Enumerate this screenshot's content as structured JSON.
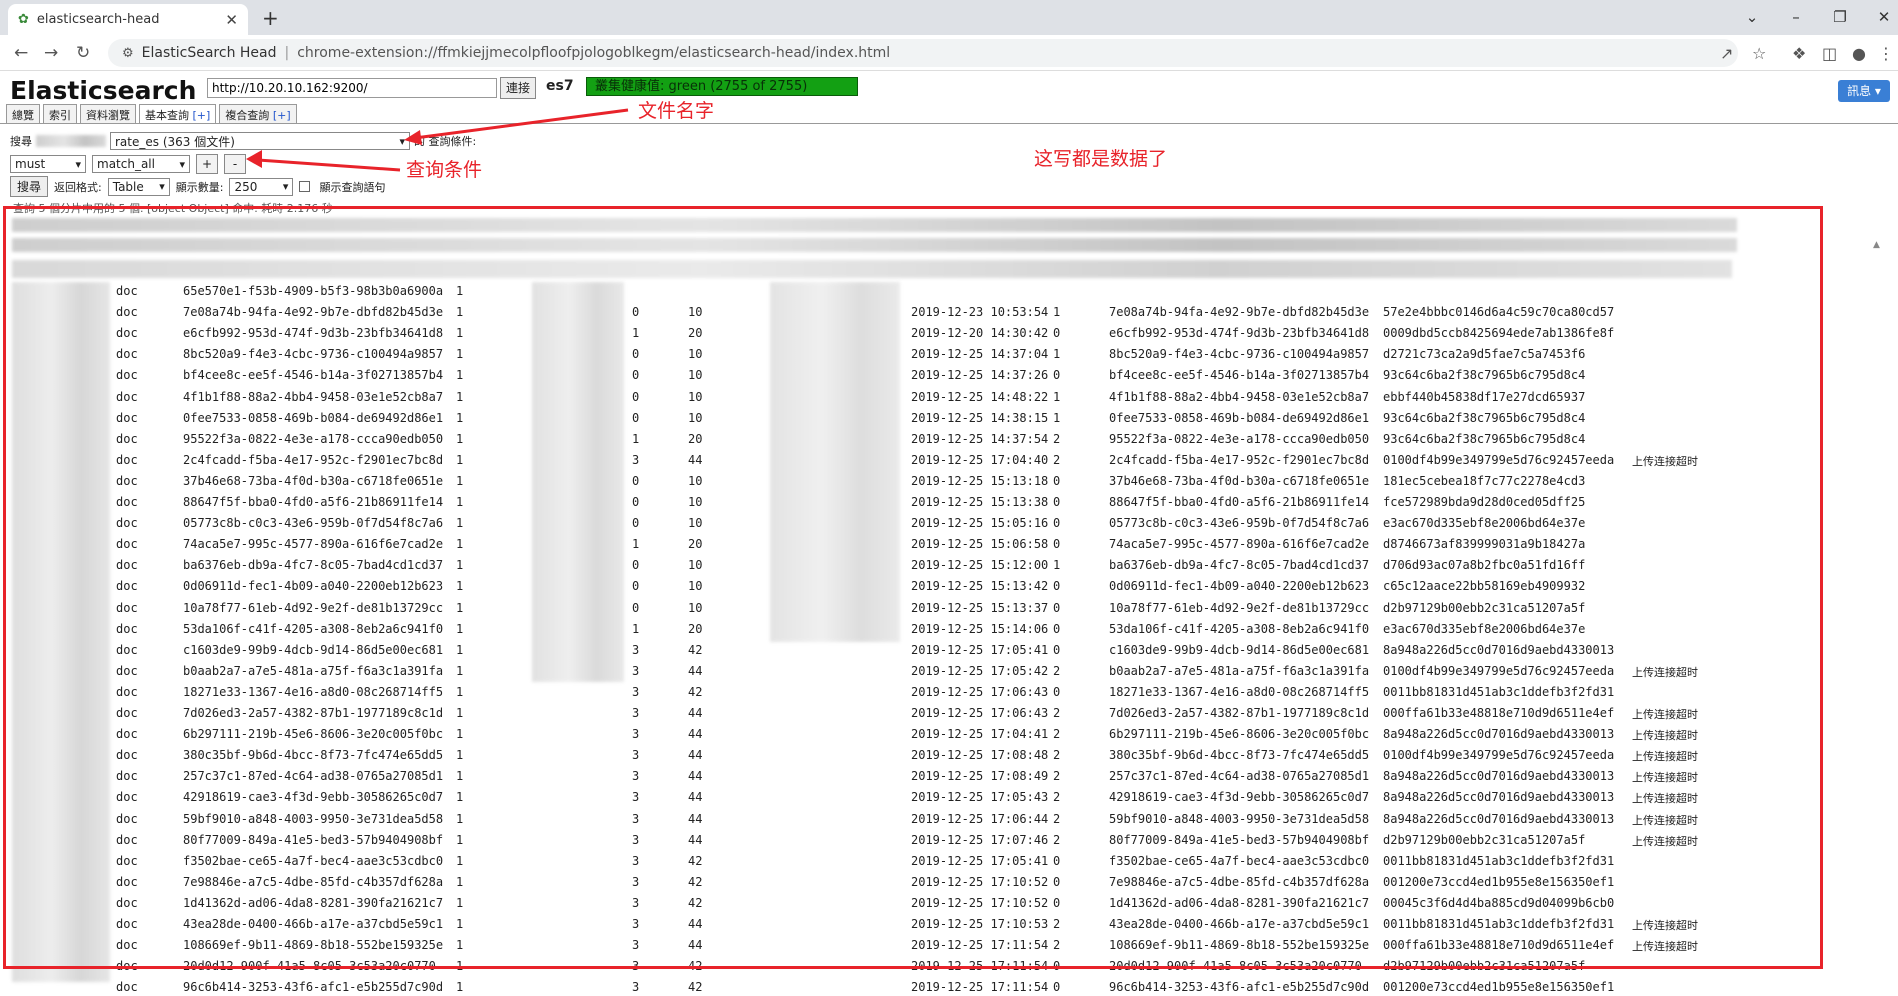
{
  "browser": {
    "tab_title": "elasticsearch-head",
    "site_name": "ElasticSearch Head",
    "url": "chrome-extension://ffmkiejjmecolpfloofpjologoblkegm/elasticsearch-head/index.html"
  },
  "app": {
    "brand": "Elasticsearch",
    "server_url": "http://10.20.10.162:9200/",
    "connect_label": "連接",
    "cluster_name": "es7",
    "health_text": "叢集健康值: green (2755 of 2755)",
    "info_label": "訊息 ▾",
    "tabs": [
      {
        "label": "總覽",
        "plus": ""
      },
      {
        "label": "索引",
        "plus": ""
      },
      {
        "label": "資料瀏覽",
        "plus": ""
      },
      {
        "label": "基本查詢",
        "plus": "[+]"
      },
      {
        "label": "複合查詢",
        "plus": "[+]"
      }
    ],
    "search_label": "搜尋",
    "index_select": "rate_es (363 個文件)",
    "query_cond_label": "的 查詢條件:",
    "must_select": "must",
    "match_select": "match_all",
    "plus_btn": "+",
    "minus_btn": "-",
    "search_button": "搜尋",
    "format_label": "返回格式:",
    "format_select": "Table",
    "size_label": "顯示數量:",
    "size_select": "250",
    "show_query_label": "顯示查詢語句",
    "status_text": "查詢 5 個分片中用的 5 個. [object Object] 命中. 耗時 2.176 秒"
  },
  "annotations": {
    "file_name": "文件名字",
    "query_cond": "查询条件",
    "data_note": "这写都是数据了"
  },
  "table": {
    "rows": [
      {
        "type": "doc",
        "id": "65e570e1-f53b-4909-b5f3-98b3b0a6900a",
        "score": "1",
        "a": "",
        "b": "",
        "date": "",
        "c": "",
        "id2": "",
        "hash": "",
        "note": ""
      },
      {
        "type": "doc",
        "id": "7e08a74b-94fa-4e92-9b7e-dbfd82b45d3e",
        "score": "1",
        "a": "0",
        "b": "10",
        "date": "2019-12-23 10:53:54",
        "c": "1",
        "id2": "7e08a74b-94fa-4e92-9b7e-dbfd82b45d3e",
        "hash": "57e2e4bbbc0146d6a4c59c70ca80cd57",
        "note": ""
      },
      {
        "type": "doc",
        "id": "e6cfb992-953d-474f-9d3b-23bfb34641d8",
        "score": "1",
        "a": "1",
        "b": "20",
        "date": "2019-12-20 14:30:42",
        "c": "0",
        "id2": "e6cfb992-953d-474f-9d3b-23bfb34641d8",
        "hash": "0009dbd5ccb8425694ede7ab1386fe8f",
        "note": ""
      },
      {
        "type": "doc",
        "id": "8bc520a9-f4e3-4cbc-9736-c100494a9857",
        "score": "1",
        "a": "0",
        "b": "10",
        "date": "2019-12-25 14:37:04",
        "c": "1",
        "id2": "8bc520a9-f4e3-4cbc-9736-c100494a9857",
        "hash": "d2721c73ca2a9d5fae7c5a7453f6",
        "note": ""
      },
      {
        "type": "doc",
        "id": "bf4cee8c-ee5f-4546-b14a-3f02713857b4",
        "score": "1",
        "a": "0",
        "b": "10",
        "date": "2019-12-25 14:37:26",
        "c": "0",
        "id2": "bf4cee8c-ee5f-4546-b14a-3f02713857b4",
        "hash": "93c64c6ba2f38c7965b6c795d8c4",
        "note": ""
      },
      {
        "type": "doc",
        "id": "4f1b1f88-88a2-4bb4-9458-03e1e52cb8a7",
        "score": "1",
        "a": "0",
        "b": "10",
        "date": "2019-12-25 14:48:22",
        "c": "1",
        "id2": "4f1b1f88-88a2-4bb4-9458-03e1e52cb8a7",
        "hash": "ebbf440b45838df17e27dcd65937",
        "note": ""
      },
      {
        "type": "doc",
        "id": "0fee7533-0858-469b-b084-de69492d86e1",
        "score": "1",
        "a": "0",
        "b": "10",
        "date": "2019-12-25 14:38:15",
        "c": "1",
        "id2": "0fee7533-0858-469b-b084-de69492d86e1",
        "hash": "93c64c6ba2f38c7965b6c795d8c4",
        "note": ""
      },
      {
        "type": "doc",
        "id": "95522f3a-0822-4e3e-a178-ccca90edb050",
        "score": "1",
        "a": "1",
        "b": "20",
        "date": "2019-12-25 14:37:54",
        "c": "2",
        "id2": "95522f3a-0822-4e3e-a178-ccca90edb050",
        "hash": "93c64c6ba2f38c7965b6c795d8c4",
        "note": ""
      },
      {
        "type": "doc",
        "id": "2c4fcadd-f5ba-4e17-952c-f2901ec7bc8d",
        "score": "1",
        "a": "3",
        "b": "44",
        "date": "2019-12-25 17:04:40",
        "c": "2",
        "id2": "2c4fcadd-f5ba-4e17-952c-f2901ec7bc8d",
        "hash": "0100df4b99e349799e5d76c92457eeda",
        "note": "上传连接超时"
      },
      {
        "type": "doc",
        "id": "37b46e68-73ba-4f0d-b30a-c6718fe0651e",
        "score": "1",
        "a": "0",
        "b": "10",
        "date": "2019-12-25 15:13:18",
        "c": "0",
        "id2": "37b46e68-73ba-4f0d-b30a-c6718fe0651e",
        "hash": "181ec5cebea18f7c77c2278e4cd3",
        "note": ""
      },
      {
        "type": "doc",
        "id": "88647f5f-bba0-4fd0-a5f6-21b86911fe14",
        "score": "1",
        "a": "0",
        "b": "10",
        "date": "2019-12-25 15:13:38",
        "c": "0",
        "id2": "88647f5f-bba0-4fd0-a5f6-21b86911fe14",
        "hash": "fce572989bda9d28d0ced05dff25",
        "note": ""
      },
      {
        "type": "doc",
        "id": "05773c8b-c0c3-43e6-959b-0f7d54f8c7a6",
        "score": "1",
        "a": "0",
        "b": "10",
        "date": "2019-12-25 15:05:16",
        "c": "0",
        "id2": "05773c8b-c0c3-43e6-959b-0f7d54f8c7a6",
        "hash": "e3ac670d335ebf8e2006bd64e37e",
        "note": ""
      },
      {
        "type": "doc",
        "id": "74aca5e7-995c-4577-890a-616f6e7cad2e",
        "score": "1",
        "a": "1",
        "b": "20",
        "date": "2019-12-25 15:06:58",
        "c": "0",
        "id2": "74aca5e7-995c-4577-890a-616f6e7cad2e",
        "hash": "d8746673af839999031a9b18427a",
        "note": ""
      },
      {
        "type": "doc",
        "id": "ba6376eb-db9a-4fc7-8c05-7bad4cd1cd37",
        "score": "1",
        "a": "0",
        "b": "10",
        "date": "2019-12-25 15:12:00",
        "c": "1",
        "id2": "ba6376eb-db9a-4fc7-8c05-7bad4cd1cd37",
        "hash": "d706d93ac07a8b2fbc0a51fd16ff",
        "note": ""
      },
      {
        "type": "doc",
        "id": "0d06911d-fec1-4b09-a040-2200eb12b623",
        "score": "1",
        "a": "0",
        "b": "10",
        "date": "2019-12-25 15:13:42",
        "c": "0",
        "id2": "0d06911d-fec1-4b09-a040-2200eb12b623",
        "hash": "c65c12aace22bb58169eb4909932",
        "note": ""
      },
      {
        "type": "doc",
        "id": "10a78f77-61eb-4d92-9e2f-de81b13729cc",
        "score": "1",
        "a": "0",
        "b": "10",
        "date": "2019-12-25 15:13:37",
        "c": "0",
        "id2": "10a78f77-61eb-4d92-9e2f-de81b13729cc",
        "hash": "d2b97129b00ebb2c31ca51207a5f",
        "note": ""
      },
      {
        "type": "doc",
        "id": "53da106f-c41f-4205-a308-8eb2a6c941f0",
        "score": "1",
        "a": "1",
        "b": "20",
        "date": "2019-12-25 15:14:06",
        "c": "0",
        "id2": "53da106f-c41f-4205-a308-8eb2a6c941f0",
        "hash": "e3ac670d335ebf8e2006bd64e37e",
        "note": ""
      },
      {
        "type": "doc",
        "id": "c1603de9-99b9-4dcb-9d14-86d5e00ec681",
        "score": "1",
        "a": "3",
        "b": "42",
        "date": "2019-12-25 17:05:41",
        "c": "0",
        "id2": "c1603de9-99b9-4dcb-9d14-86d5e00ec681",
        "hash": "8a948a226d5cc0d7016d9aebd4330013",
        "note": ""
      },
      {
        "type": "doc",
        "id": "b0aab2a7-a7e5-481a-a75f-f6a3c1a391fa",
        "score": "1",
        "a": "3",
        "b": "44",
        "date": "2019-12-25 17:05:42",
        "c": "2",
        "id2": "b0aab2a7-a7e5-481a-a75f-f6a3c1a391fa",
        "hash": "0100df4b99e349799e5d76c92457eeda",
        "note": "上传连接超时"
      },
      {
        "type": "doc",
        "id": "18271e33-1367-4e16-a8d0-08c268714ff5",
        "score": "1",
        "a": "3",
        "b": "42",
        "date": "2019-12-25 17:06:43",
        "c": "0",
        "id2": "18271e33-1367-4e16-a8d0-08c268714ff5",
        "hash": "0011bb81831d451ab3c1ddefb3f2fd31",
        "note": ""
      },
      {
        "type": "doc",
        "id": "7d026ed3-2a57-4382-87b1-1977189c8c1d",
        "score": "1",
        "a": "3",
        "b": "44",
        "date": "2019-12-25 17:06:43",
        "c": "2",
        "id2": "7d026ed3-2a57-4382-87b1-1977189c8c1d",
        "hash": "000ffa61b33e48818e710d9d6511e4ef",
        "note": "上传连接超时"
      },
      {
        "type": "doc",
        "id": "6b297111-219b-45e6-8606-3e20c005f0bc",
        "score": "1",
        "a": "3",
        "b": "44",
        "date": "2019-12-25 17:04:41",
        "c": "2",
        "id2": "6b297111-219b-45e6-8606-3e20c005f0bc",
        "hash": "8a948a226d5cc0d7016d9aebd4330013",
        "note": "上传连接超时"
      },
      {
        "type": "doc",
        "id": "380c35bf-9b6d-4bcc-8f73-7fc474e65dd5",
        "score": "1",
        "a": "3",
        "b": "44",
        "date": "2019-12-25 17:08:48",
        "c": "2",
        "id2": "380c35bf-9b6d-4bcc-8f73-7fc474e65dd5",
        "hash": "0100df4b99e349799e5d76c92457eeda",
        "note": "上传连接超时"
      },
      {
        "type": "doc",
        "id": "257c37c1-87ed-4c64-ad38-0765a27085d1",
        "score": "1",
        "a": "3",
        "b": "44",
        "date": "2019-12-25 17:08:49",
        "c": "2",
        "id2": "257c37c1-87ed-4c64-ad38-0765a27085d1",
        "hash": "8a948a226d5cc0d7016d9aebd4330013",
        "note": "上传连接超时"
      },
      {
        "type": "doc",
        "id": "42918619-cae3-4f3d-9ebb-30586265c0d7",
        "score": "1",
        "a": "3",
        "b": "44",
        "date": "2019-12-25 17:05:43",
        "c": "2",
        "id2": "42918619-cae3-4f3d-9ebb-30586265c0d7",
        "hash": "8a948a226d5cc0d7016d9aebd4330013",
        "note": "上传连接超时"
      },
      {
        "type": "doc",
        "id": "59bf9010-a848-4003-9950-3e731dea5d58",
        "score": "1",
        "a": "3",
        "b": "44",
        "date": "2019-12-25 17:06:44",
        "c": "2",
        "id2": "59bf9010-a848-4003-9950-3e731dea5d58",
        "hash": "8a948a226d5cc0d7016d9aebd4330013",
        "note": "上传连接超时"
      },
      {
        "type": "doc",
        "id": "80f77009-849a-41e5-bed3-57b9404908bf",
        "score": "1",
        "a": "3",
        "b": "44",
        "date": "2019-12-25 17:07:46",
        "c": "2",
        "id2": "80f77009-849a-41e5-bed3-57b9404908bf",
        "hash": "d2b97129b00ebb2c31ca51207a5f",
        "note": "上传连接超时"
      },
      {
        "type": "doc",
        "id": "f3502bae-ce65-4a7f-bec4-aae3c53cdbc0",
        "score": "1",
        "a": "3",
        "b": "42",
        "date": "2019-12-25 17:05:41",
        "c": "0",
        "id2": "f3502bae-ce65-4a7f-bec4-aae3c53cdbc0",
        "hash": "0011bb81831d451ab3c1ddefb3f2fd31",
        "note": ""
      },
      {
        "type": "doc",
        "id": "7e98846e-a7c5-4dbe-85fd-c4b357df628a",
        "score": "1",
        "a": "3",
        "b": "42",
        "date": "2019-12-25 17:10:52",
        "c": "0",
        "id2": "7e98846e-a7c5-4dbe-85fd-c4b357df628a",
        "hash": "001200e73ccd4ed1b955e8e156350ef1",
        "note": ""
      },
      {
        "type": "doc",
        "id": "1d41362d-ad06-4da8-8281-390fa21621c7",
        "score": "1",
        "a": "3",
        "b": "42",
        "date": "2019-12-25 17:10:52",
        "c": "0",
        "id2": "1d41362d-ad06-4da8-8281-390fa21621c7",
        "hash": "00045c3f6d4d4ba885cd9d04099b6cb0",
        "note": ""
      },
      {
        "type": "doc",
        "id": "43ea28de-0400-466b-a17e-a37cbd5e59c1",
        "score": "1",
        "a": "3",
        "b": "44",
        "date": "2019-12-25 17:10:53",
        "c": "2",
        "id2": "43ea28de-0400-466b-a17e-a37cbd5e59c1",
        "hash": "0011bb81831d451ab3c1ddefb3f2fd31",
        "note": "上传连接超时"
      },
      {
        "type": "doc",
        "id": "108669ef-9b11-4869-8b18-552be159325e",
        "score": "1",
        "a": "3",
        "b": "44",
        "date": "2019-12-25 17:11:54",
        "c": "2",
        "id2": "108669ef-9b11-4869-8b18-552be159325e",
        "hash": "000ffa61b33e48818e710d9d6511e4ef",
        "note": "上传连接超时"
      },
      {
        "type": "doc",
        "id": "20d0d12-900f-41a5-8c05-3c53a20c0770",
        "score": "1",
        "a": "3",
        "b": "42",
        "date": "2019-12-25 17:11:54",
        "c": "0",
        "id2": "20d0d12-900f-41a5-8c05-3c53a20c0770",
        "hash": "d2b97129b00ebb2c31ca51207a5f",
        "note": ""
      },
      {
        "type": "doc",
        "id": "96c6b414-3253-43f6-afc1-e5b255d7c90d",
        "score": "1",
        "a": "3",
        "b": "42",
        "date": "2019-12-25 17:11:54",
        "c": "0",
        "id2": "96c6b414-3253-43f6-afc1-e5b255d7c90d",
        "hash": "001200e73ccd4ed1b955e8e156350ef1",
        "note": ""
      }
    ]
  }
}
